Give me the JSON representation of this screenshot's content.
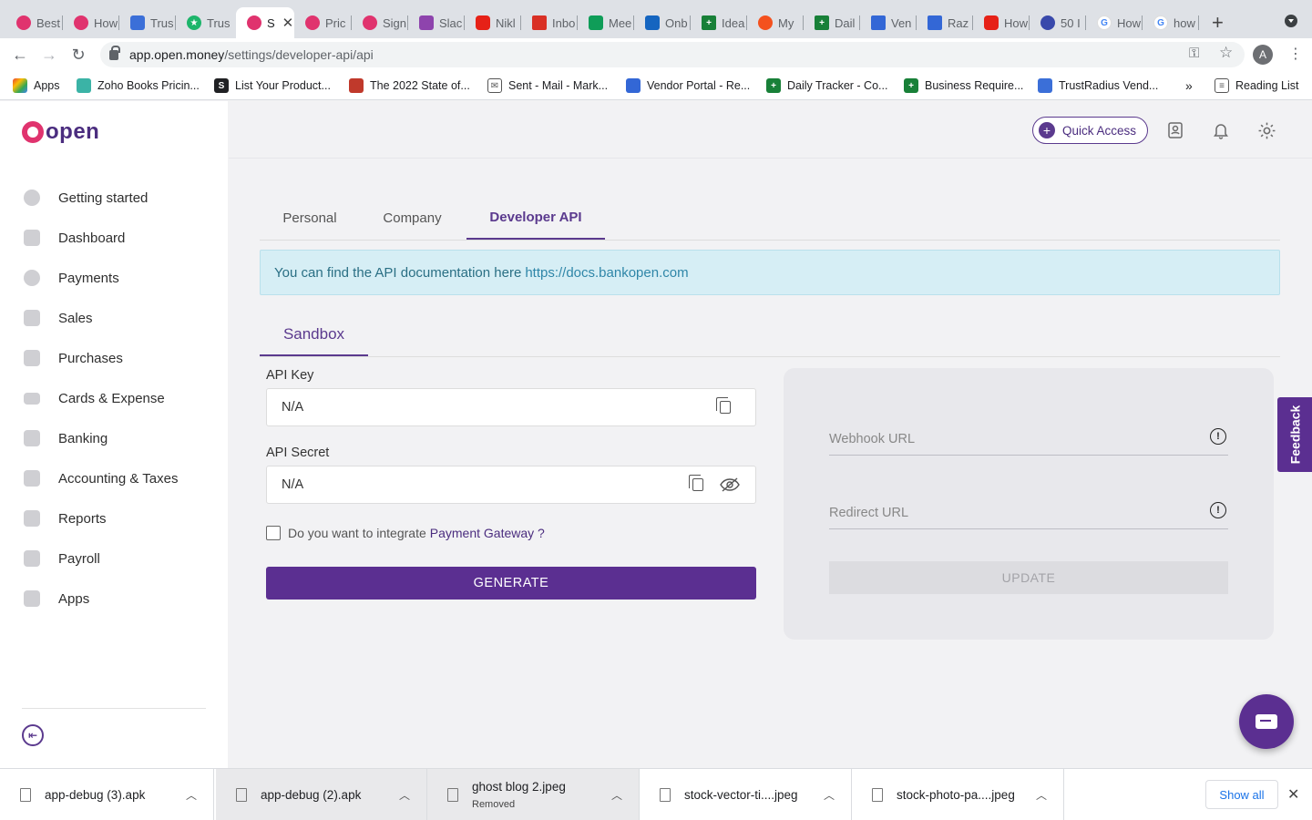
{
  "browser": {
    "tabs": [
      {
        "label": "Best",
        "color": "#e0336e"
      },
      {
        "label": "How",
        "color": "#e0336e"
      },
      {
        "label": "Trus",
        "color": "#3b6fd8"
      },
      {
        "label": "Trus",
        "color": "#1db56b"
      },
      {
        "label": "S",
        "color": "#e0336e",
        "active": true
      },
      {
        "label": "Pric",
        "color": "#e0336e"
      },
      {
        "label": "Sign",
        "color": "#e0336e"
      },
      {
        "label": "Slac",
        "color": "#8e44ad"
      },
      {
        "label": "Nikl",
        "color": "#e62117"
      },
      {
        "label": "Inbo",
        "color": "#d93025"
      },
      {
        "label": "Mee",
        "color": "#0f9d58"
      },
      {
        "label": "Onb",
        "color": "#1565c0"
      },
      {
        "label": "Idea",
        "color": "#188038"
      },
      {
        "label": "My",
        "color": "#f4511e"
      },
      {
        "label": "Dail",
        "color": "#188038"
      },
      {
        "label": "Ven",
        "color": "#3367d6"
      },
      {
        "label": "Raz",
        "color": "#3367d6"
      },
      {
        "label": "How",
        "color": "#e62117"
      },
      {
        "label": "50 I",
        "color": "#3949ab"
      },
      {
        "label": "How",
        "color": "#4285f4"
      },
      {
        "label": "how",
        "color": "#4285f4"
      }
    ],
    "url_host": "app.open.money",
    "url_path": "/settings/developer-api/api",
    "profile_initial": "A",
    "bookmarks": [
      {
        "label": "Apps",
        "color": "#e94235"
      },
      {
        "label": "Zoho Books Pricin...",
        "color": "#3bb3a6"
      },
      {
        "label": "List Your Product...",
        "color": "#202124"
      },
      {
        "label": "The 2022 State of...",
        "color": "#c0392b"
      },
      {
        "label": "Sent - Mail - Mark...",
        "color": "#555555"
      },
      {
        "label": "Vendor Portal - Re...",
        "color": "#3367d6"
      },
      {
        "label": "Daily Tracker - Co...",
        "color": "#188038"
      },
      {
        "label": "Business Require...",
        "color": "#188038"
      },
      {
        "label": "TrustRadius Vend...",
        "color": "#3b6fd8"
      }
    ],
    "more_bookmarks": "»",
    "reading_list": "Reading List"
  },
  "brand": {
    "name": "open",
    "accent": "#5b2f91",
    "logo_color": "#e0336e"
  },
  "sidebar": {
    "items": [
      {
        "label": "Getting started"
      },
      {
        "label": "Dashboard"
      },
      {
        "label": "Payments"
      },
      {
        "label": "Sales"
      },
      {
        "label": "Purchases"
      },
      {
        "label": "Cards & Expense"
      },
      {
        "label": "Banking"
      },
      {
        "label": "Accounting & Taxes"
      },
      {
        "label": "Reports"
      },
      {
        "label": "Payroll"
      },
      {
        "label": "Apps"
      }
    ]
  },
  "header": {
    "quick_access": "Quick Access"
  },
  "settings_tabs": [
    {
      "label": "Personal"
    },
    {
      "label": "Company"
    },
    {
      "label": "Developer API",
      "active": true
    }
  ],
  "info_banner": {
    "text": "You can find the API documentation here",
    "link": "https://docs.bankopen.com"
  },
  "env_tab": "Sandbox",
  "api_key": {
    "label": "API Key",
    "value": "N/A"
  },
  "api_secret": {
    "label": "API Secret",
    "value": "N/A"
  },
  "gateway_check": {
    "prefix": "Do you want to integrate",
    "link": "Payment Gateway ?",
    "checked": false
  },
  "generate_label": "GENERATE",
  "webhook": {
    "placeholder": "Webhook URL"
  },
  "redirect": {
    "placeholder": "Redirect URL"
  },
  "update_label": "UPDATE",
  "feedback_label": "Feedback",
  "downloads": {
    "items": [
      {
        "name": "app-debug (3).apk",
        "sub": ""
      },
      {
        "name": "app-debug (2).apk",
        "sub": ""
      },
      {
        "name": "ghost blog 2.jpeg",
        "sub": "Removed"
      },
      {
        "name": "stock-vector-ti....jpeg",
        "sub": ""
      },
      {
        "name": "stock-photo-pa....jpeg",
        "sub": ""
      }
    ],
    "show_all": "Show all"
  }
}
